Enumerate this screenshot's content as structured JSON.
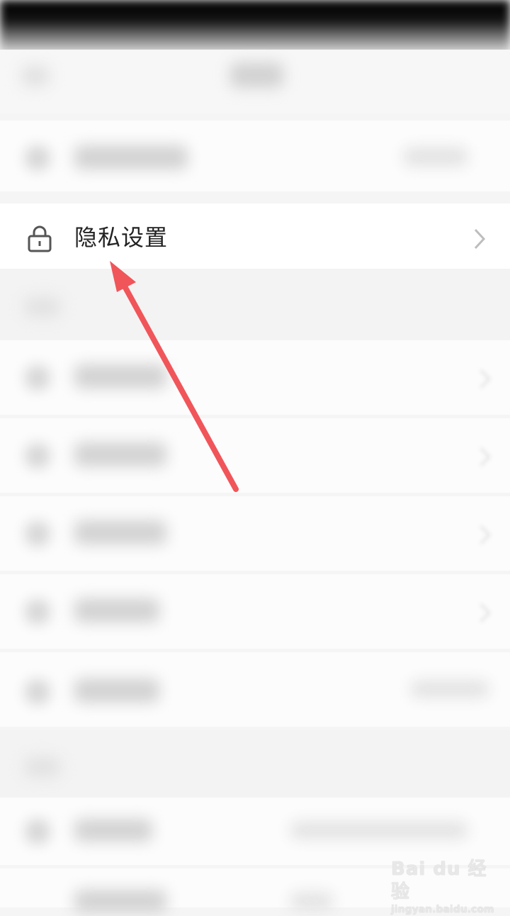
{
  "privacy_row": {
    "label": "隐私设置",
    "lock_icon": "lock-icon",
    "chevron_icon": "chevron-right-icon"
  },
  "watermark": {
    "line1": "Bai du 经验",
    "line2": "jingyan.baidu.com"
  },
  "colors": {
    "arrow": "#f0555a",
    "label_text": "#222222",
    "background": "#f5f5f5"
  }
}
